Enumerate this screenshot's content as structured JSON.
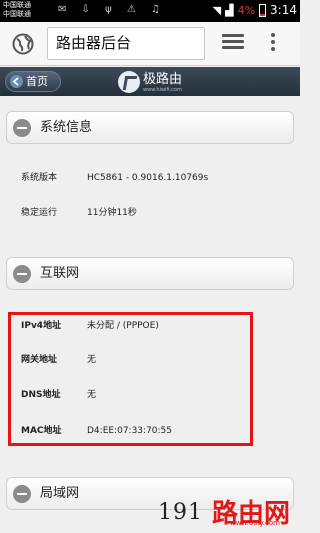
{
  "status_bar": {
    "carrier_1": "中国联通",
    "carrier_2": "中国联通",
    "battery": "4%",
    "time": "3:14"
  },
  "browser": {
    "url_text": "路由器后台",
    "icons": [
      "globe-icon",
      "tabs-icon",
      "overflow-menu-icon"
    ]
  },
  "header": {
    "home_label": "首页",
    "logo_text": "极路由",
    "logo_url": "www.hiwifi.com"
  },
  "sections": {
    "system": {
      "title": "系统信息",
      "version_label": "系统版本",
      "version_value": "HC5861 - 0.9016.1.10769s",
      "uptime_label": "稳定运行",
      "uptime_value": "11分钟11秒"
    },
    "internet": {
      "title": "互联网",
      "ipv4_label": "IPv4地址",
      "ipv4_value": "未分配 / (PPPOE)",
      "gateway_label": "网关地址",
      "gateway_value": "无",
      "dns_label": "DNS地址",
      "dns_value": "无",
      "mac_label": "MAC地址",
      "mac_value": "D4:EE:07:33:70:55"
    },
    "lan": {
      "title": "局域网"
    }
  },
  "watermark": {
    "number": "191",
    "cn": "路由网",
    "url": "www.65ly.com"
  },
  "colors": {
    "highlight": "#e51414",
    "header_bg": "#2c3845",
    "status_bar_bg": "#000000"
  }
}
